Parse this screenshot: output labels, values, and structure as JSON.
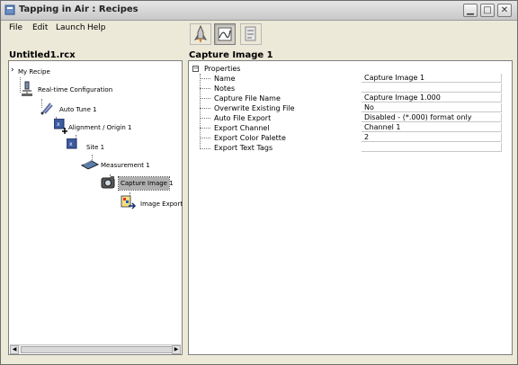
{
  "window": {
    "title": "Tapping in Air : Recipes"
  },
  "menu": [
    "File",
    "Edit",
    "Launch",
    "Help"
  ],
  "toolbar": {
    "buttons": [
      {
        "icon": "rocket-icon",
        "active": false
      },
      {
        "icon": "chart-icon",
        "active": true
      },
      {
        "icon": "document-icon",
        "active": false
      }
    ]
  },
  "left_panel": {
    "title": "Untitled1.rcx"
  },
  "tree": {
    "items": [
      {
        "label": "My Recipe",
        "icon": "chevron-icon"
      },
      {
        "label": "Real-time Configuration",
        "icon": "microscope-icon"
      },
      {
        "label": "Auto Tune 1",
        "icon": "tuning-fork-icon"
      },
      {
        "label": "Alignment / Origin 1",
        "icon": "crosshair-icon"
      },
      {
        "label": "Site 1",
        "icon": "site-icon"
      },
      {
        "label": "Measurement 1",
        "icon": "measurement-icon"
      },
      {
        "label": "Capture Image 1",
        "icon": "camera-icon",
        "selected": true
      },
      {
        "label": "Image Export",
        "icon": "image-export-icon"
      }
    ]
  },
  "right_panel": {
    "title": "Capture Image 1"
  },
  "properties": {
    "header": "Properties",
    "rows": [
      {
        "name": "Name",
        "value": "Capture Image 1"
      },
      {
        "name": "Notes",
        "value": ""
      },
      {
        "name": "Capture File Name",
        "value": "Capture Image 1.000"
      },
      {
        "name": "Overwrite Existing File",
        "value": "No"
      },
      {
        "name": "Auto File Export",
        "value": "Disabled - (*.000) format only"
      },
      {
        "name": "Export Channel",
        "value": "Channel 1"
      },
      {
        "name": "Export Color Palette",
        "value": "2"
      },
      {
        "name": "Export Text Tags",
        "value": ""
      }
    ]
  }
}
